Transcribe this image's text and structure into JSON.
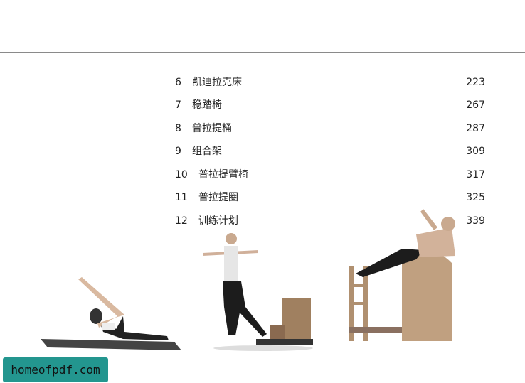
{
  "toc": [
    {
      "number": "6",
      "title": "凯迪拉克床",
      "page": "223"
    },
    {
      "number": "7",
      "title": "稳踏椅",
      "page": "267"
    },
    {
      "number": "8",
      "title": "普拉提桶",
      "page": "287"
    },
    {
      "number": "9",
      "title": "组合架",
      "page": "309"
    },
    {
      "number": "10",
      "title": "普拉提臂椅",
      "page": "317"
    },
    {
      "number": "11",
      "title": "普拉提圈",
      "page": "325"
    },
    {
      "number": "12",
      "title": "训练计划",
      "page": "339"
    }
  ],
  "watermark": "homeofpdf.com"
}
